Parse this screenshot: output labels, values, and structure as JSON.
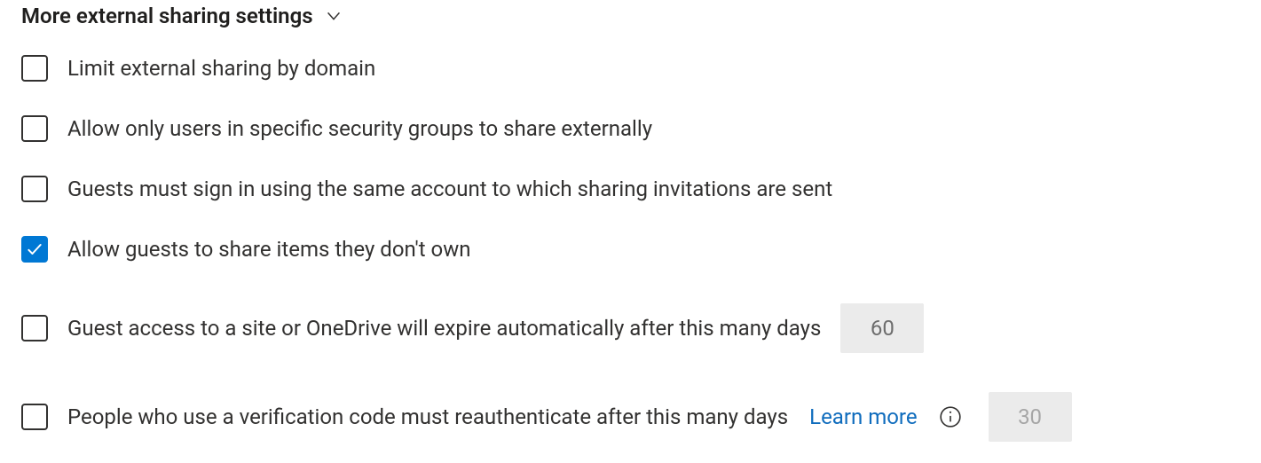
{
  "section": {
    "title": "More external sharing settings"
  },
  "options": {
    "limit_by_domain": {
      "label": "Limit external sharing by domain",
      "checked": false
    },
    "security_groups": {
      "label": "Allow only users in specific security groups to share externally",
      "checked": false
    },
    "guests_same_account": {
      "label": "Guests must sign in using the same account to which sharing invitations are sent",
      "checked": false
    },
    "guests_share_not_own": {
      "label": "Allow guests to share items they don't own",
      "checked": true
    },
    "guest_expire": {
      "label": "Guest access to a site or OneDrive will expire automatically after this many days",
      "checked": false,
      "value": "60"
    },
    "verification_reauth": {
      "label": "People who use a verification code must reauthenticate after this many days",
      "checked": false,
      "value": "30",
      "learn_more": "Learn more"
    }
  }
}
